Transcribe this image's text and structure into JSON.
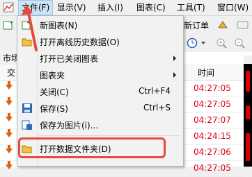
{
  "menubar": {
    "items": [
      "文件(F)",
      "显示(V)",
      "插入(I)",
      "图表(C)",
      "工具(T)",
      "窗口(W)"
    ]
  },
  "toolbar": {
    "new_order_label": "新订单"
  },
  "background": {
    "tab_label": "市场",
    "column_left": "交",
    "column_time": "时间",
    "times": [
      "04:27:05",
      "04:27:05",
      "04:27:07",
      "04:24:15",
      "04:27:06",
      "04:27:05",
      "04:27:05"
    ]
  },
  "file_menu": {
    "items": [
      {
        "label": "新图表(N)",
        "shortcut": "",
        "submenu": false,
        "icon": "new-chart-icon"
      },
      {
        "label": "打开离线历史数据(O)",
        "shortcut": "",
        "submenu": false,
        "icon": "open-folder-icon"
      },
      {
        "label": "打开已关闭图表",
        "shortcut": "",
        "submenu": true,
        "icon": ""
      },
      {
        "label": "图表夹",
        "shortcut": "",
        "submenu": true,
        "icon": ""
      },
      {
        "label": "关闭(C)",
        "shortcut": "Ctrl+F4",
        "submenu": false,
        "icon": ""
      },
      {
        "label": "保存(S)",
        "shortcut": "Ctrl+S",
        "submenu": false,
        "icon": "save-icon"
      },
      {
        "label": "保存为图片(i)...",
        "shortcut": "",
        "submenu": false,
        "icon": "save-image-icon"
      },
      {
        "label": "打开数据文件夹(D)",
        "shortcut": "",
        "submenu": false,
        "icon": "data-folder-icon"
      }
    ]
  },
  "colors": {
    "highlight": "#e8493a",
    "time_red": "#e0001c",
    "menu_active": "#cce4f7"
  }
}
